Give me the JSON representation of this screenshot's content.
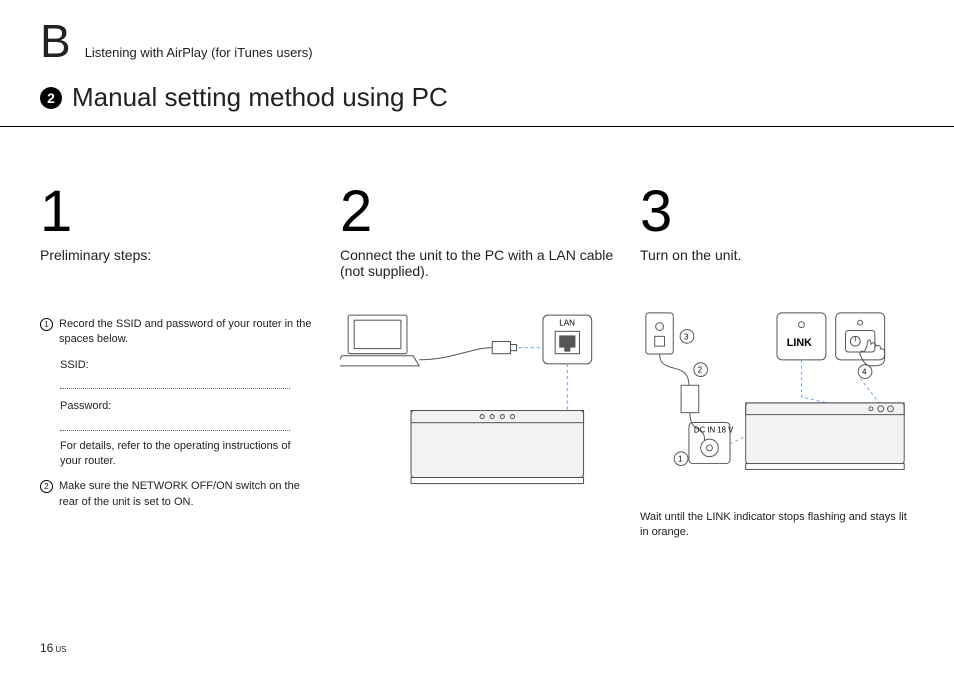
{
  "header": {
    "section_letter": "B",
    "section_subtitle": "Listening with AirPlay (for iTunes users)"
  },
  "subheader": {
    "number": "2",
    "title": "Manual setting method using PC"
  },
  "steps": [
    {
      "number": "1",
      "title": "Preliminary steps:",
      "items": [
        {
          "marker": "1",
          "text": "Record the SSID and password of your router in the spaces below."
        },
        {
          "marker": "2",
          "text": "Make sure the NETWORK OFF/ON switch on the rear of the unit is set to ON."
        }
      ],
      "fields": {
        "ssid_label": "SSID:",
        "password_label": "Password:",
        "details": "For details, refer to the operating instructions of your router."
      }
    },
    {
      "number": "2",
      "title": "Connect the unit to the PC with a LAN cable (not supplied).",
      "diagram": {
        "port_label": "LAN"
      }
    },
    {
      "number": "3",
      "title": "Turn on the unit.",
      "diagram": {
        "markers": [
          "1",
          "2",
          "3",
          "4"
        ],
        "link_label": "LINK",
        "dc_label": "DC IN 18 V"
      },
      "note": "Wait until the LINK indicator stops flashing and stays lit in orange."
    }
  ],
  "footer": {
    "page": "16",
    "region": "US"
  }
}
